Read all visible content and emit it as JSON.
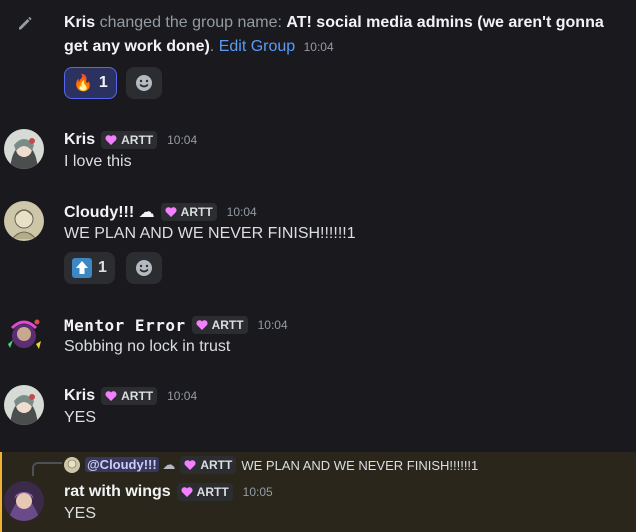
{
  "system_message": {
    "user": "Kris",
    "action": "changed the group name:",
    "group_name": "AT! social media admins (we aren't gonna get any work done)",
    "link": "Edit Group",
    "time": "10:04",
    "reaction": {
      "emoji": "🔥",
      "count": "1"
    }
  },
  "messages": [
    {
      "user": "Kris",
      "tag": "ARTT",
      "time": "10:04",
      "text": "I love this"
    },
    {
      "user": "Cloudy!!!",
      "user_suffix": "☁",
      "tag": "ARTT",
      "time": "10:04",
      "text": "WE PLAN AND WE NEVER FINISH!!!!!!1",
      "reaction": {
        "emoji": "⬆",
        "count": "1"
      }
    },
    {
      "user": "Mentor Error",
      "tag": "ARTT",
      "time": "10:04",
      "text": "Sobbing no lock in trust"
    },
    {
      "user": "Kris",
      "tag": "ARTT",
      "time": "10:04",
      "text": "YES"
    },
    {
      "reply_to": {
        "user": "@Cloudy!!!",
        "user_suffix": "☁",
        "tag": "ARTT",
        "text": "WE PLAN AND WE NEVER FINISH!!!!!!1"
      },
      "user": "rat with wings",
      "tag": "ARTT",
      "time": "10:05",
      "text": "YES"
    }
  ],
  "colors": {
    "background": "#1a1a1e",
    "link": "#5a9cf7",
    "highlight": "#2b261b",
    "highlight_bar": "#f0b232",
    "tag_heart": "#f47fff"
  }
}
